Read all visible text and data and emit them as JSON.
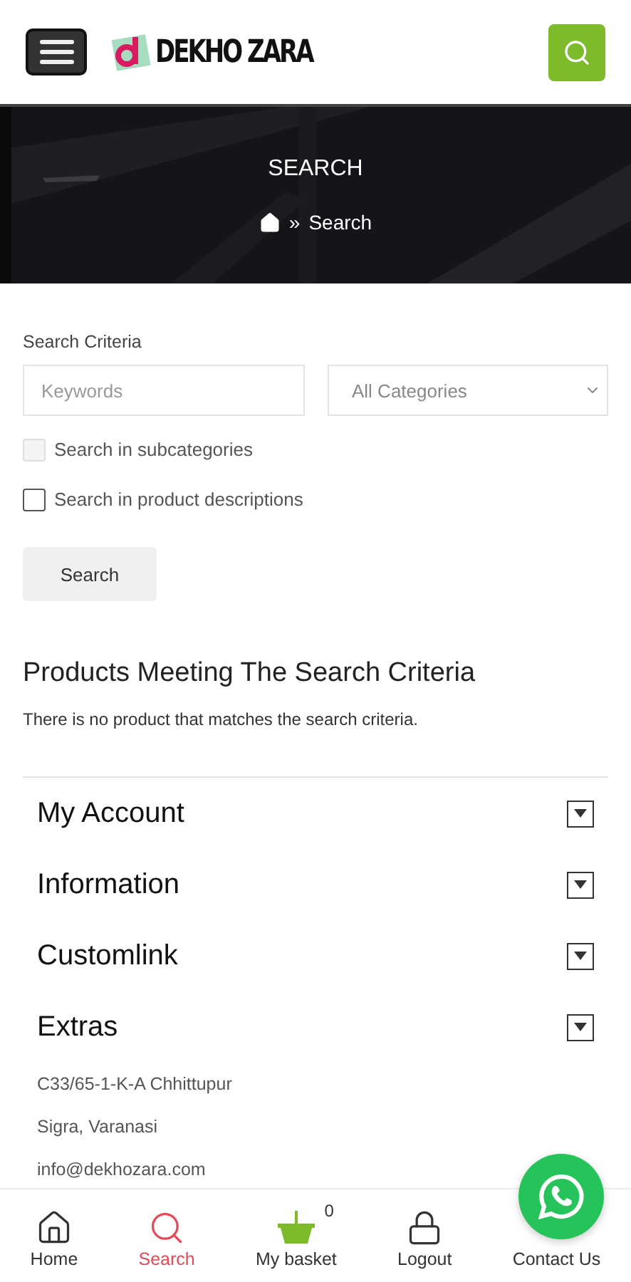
{
  "header": {
    "brand": "DEKHO ZARA"
  },
  "banner": {
    "title": "SEARCH",
    "breadcrumb": [
      {
        "kind": "home"
      },
      {
        "kind": "text",
        "label": "Search"
      }
    ],
    "separator": "»"
  },
  "form": {
    "label": "Search Criteria",
    "keywords": {
      "placeholder": "Keywords"
    },
    "category": {
      "value": "All Categories"
    },
    "options": [
      {
        "label": "Search in subcategories",
        "checked": false,
        "disabled": true
      },
      {
        "label": "Search in product descriptions",
        "checked": false,
        "disabled": false
      }
    ],
    "button": "Search"
  },
  "results": {
    "heading": "Products Meeting The Search Criteria",
    "message": "There is no product that matches the search criteria."
  },
  "footer_sections": [
    {
      "title": "My Account",
      "expanded": false
    },
    {
      "title": "Information",
      "expanded": false
    },
    {
      "title": "Customlink",
      "expanded": false
    },
    {
      "title": "Extras",
      "expanded": false
    }
  ],
  "address": [
    "C33/65-1-K-A Chhittupur",
    "Sigra, Varanasi",
    "info@dekhozara.com"
  ],
  "bottom_nav": [
    {
      "kind": "home",
      "label": "Home",
      "selected": false
    },
    {
      "kind": "search",
      "label": "Search",
      "selected": true
    },
    {
      "kind": "basket",
      "label": "My basket",
      "selected": false,
      "count": "0"
    },
    {
      "kind": "logout",
      "label": "Logout",
      "selected": false
    },
    {
      "kind": "contact",
      "label": "Contact Us",
      "selected": false
    }
  ]
}
